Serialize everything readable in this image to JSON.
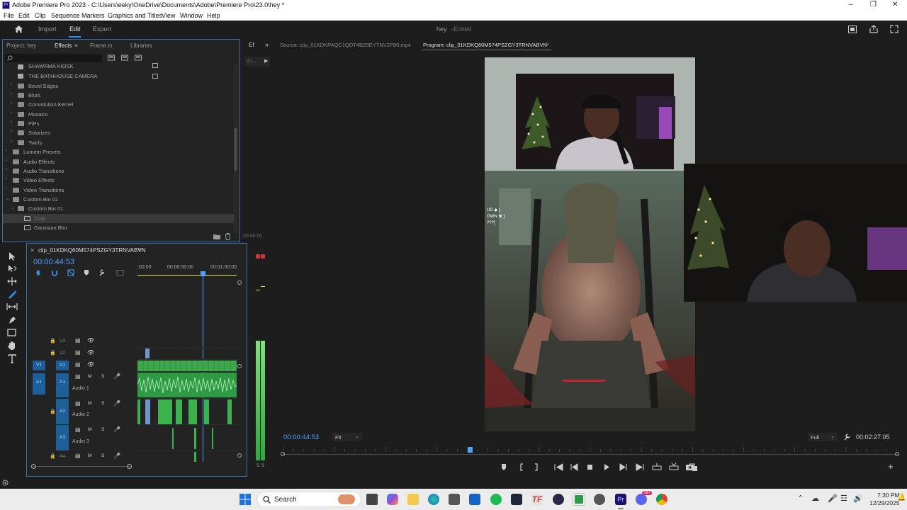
{
  "title_bar": {
    "app_title": "Adobe Premiere Pro 2023 - C:\\Users\\eeky\\OneDrive\\Documents\\Adobe\\Premiere Pro\\23.0\\hey *",
    "logo": "Pr"
  },
  "menu": [
    "File",
    "Edit",
    "Clip",
    "Sequence",
    "Markers",
    "Graphics and Titles",
    "View",
    "Window",
    "Help"
  ],
  "workspace": {
    "tabs": [
      "Import",
      "Edit",
      "Export"
    ],
    "active": "Edit",
    "project_name": "hey",
    "status": "Edited"
  },
  "project_panel": {
    "tabs": [
      "Project: hey",
      "Effects",
      "Frame.io",
      "Libraries"
    ],
    "side_tabs": [
      "Ef",
      "(n..."
    ],
    "items": [
      {
        "label": "SHAWRMA KIOSK",
        "level": 2,
        "type": "preset"
      },
      {
        "label": "THE BATHHOUSE CAMERA",
        "level": 2,
        "type": "preset"
      },
      {
        "label": "Bevel Edges",
        "level": 1,
        "type": "folder"
      },
      {
        "label": "Blurs",
        "level": 1,
        "type": "folder"
      },
      {
        "label": "Convolution Kernel",
        "level": 1,
        "type": "folder"
      },
      {
        "label": "Mosaics",
        "level": 1,
        "type": "folder"
      },
      {
        "label": "PiPs",
        "level": 1,
        "type": "folder"
      },
      {
        "label": "Solarizes",
        "level": 1,
        "type": "folder"
      },
      {
        "label": "Twirls",
        "level": 1,
        "type": "folder"
      },
      {
        "label": "Lumetri Presets",
        "level": 0,
        "type": "folder"
      },
      {
        "label": "Audio Effects",
        "level": 0,
        "type": "folder"
      },
      {
        "label": "Audio Transitions",
        "level": 0,
        "type": "folder"
      },
      {
        "label": "Video Effects",
        "level": 0,
        "type": "folder"
      },
      {
        "label": "Video Transitions",
        "level": 0,
        "type": "folder"
      },
      {
        "label": "Custom Bin 01",
        "level": 0,
        "type": "folder"
      },
      {
        "label": "Custom Bin 01",
        "level": 1,
        "type": "folder"
      },
      {
        "label": "Crop",
        "level": 2,
        "type": "effect"
      },
      {
        "label": "Gaussian Blur",
        "level": 2,
        "type": "effect"
      }
    ],
    "mini_timecode": "00:00:00"
  },
  "timeline": {
    "sequence_name": "clip_01KDKQ60M574PSZGY3TRNVABVN",
    "timecode": "00:00:44:53",
    "ruler": [
      ":00:00",
      "00:00:30:00",
      "00:01:00:00"
    ],
    "tracks": [
      {
        "id": "V3",
        "label": ""
      },
      {
        "id": "V2",
        "label": ""
      },
      {
        "id": "V1",
        "src": "V1",
        "label": ""
      },
      {
        "id": "A1",
        "src": "A1",
        "label": "Audio 1"
      },
      {
        "id": "A2",
        "label": "Audio 2"
      },
      {
        "id": "A3",
        "label": "Audio 3"
      },
      {
        "id": "A4",
        "label": ""
      }
    ],
    "track_buttons": {
      "mute": "M",
      "solo": "S"
    }
  },
  "meter": {
    "labels": [
      "S",
      "S"
    ],
    "level": 0.72
  },
  "program_monitor": {
    "source_tab": "Source: clip_01KDKPAQC1QDT4BZ9EYTNV2P80.mp4",
    "program_tab": "Program: clip_01KDKQ60M574PSZGY3TRNVABVN",
    "timecode": "00:00:44:53",
    "fit": "Fit",
    "quality": "Full",
    "duration": "00:02:27:05",
    "playhead_fraction": 0.305,
    "game_overlay_text": [
      "UD ◆ ]",
      "OWN ♚ ]",
      "???]"
    ]
  },
  "taskbar": {
    "search_placeholder": "Search",
    "time": "7:30 PM",
    "date": "12/29/2025",
    "badge": "99+"
  },
  "colors": {
    "accent": "#2d8ceb",
    "selection": "#3a6fb0",
    "audio_clip": "#3cb24f",
    "video_clip": "#45c15a",
    "timecode": "#4aa3ff"
  }
}
